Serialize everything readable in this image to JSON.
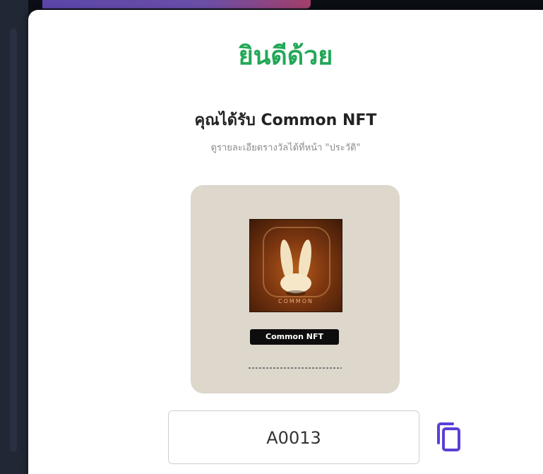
{
  "modal": {
    "title": "ยินดีด้วย",
    "subtitle": "คุณได้รับ Common NFT",
    "hint": "ดูรายละเอียดรางวัลได้ที่หน้า \"ประวัติ\""
  },
  "nft": {
    "art_label": "COMMON",
    "name": "Common NFT"
  },
  "reward_code": {
    "value": "A0013",
    "copy_icon": "copy-icon"
  },
  "colors": {
    "title": "#22a857",
    "copy_icon": "#5b3fd6",
    "card_bg": "#ddd7cc",
    "badge_bg": "#0d0d0d"
  }
}
